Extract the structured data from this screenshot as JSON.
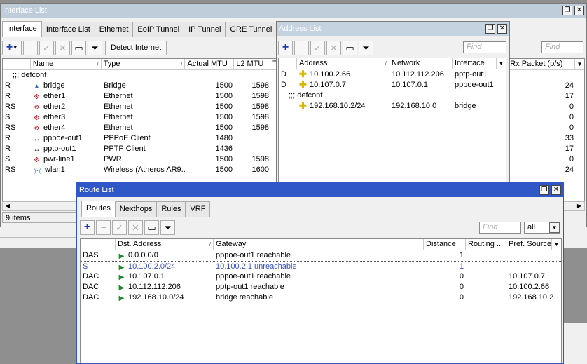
{
  "interface_window": {
    "title": "Interface List",
    "tabs": [
      "Interface",
      "Interface List",
      "Ethernet",
      "EoIP Tunnel",
      "IP Tunnel",
      "GRE Tunnel"
    ],
    "detect_internet": "Detect Internet",
    "find_placeholder": "Find",
    "columns": [
      "Name",
      "Type",
      "Actual MTU",
      "L2 MTU",
      "T"
    ],
    "rx_column": "Rx Packet (p/s)",
    "group": ";;; defconf",
    "rows": [
      {
        "flag": "R",
        "icon": "bridge-icon",
        "name": "bridge",
        "type": "Bridge",
        "mtu": "1500",
        "l2mtu": "1598",
        "rx": "24"
      },
      {
        "flag": "R",
        "icon": "ethernet-icon",
        "name": "ether1",
        "type": "Ethernet",
        "mtu": "1500",
        "l2mtu": "1598",
        "rx": "17"
      },
      {
        "flag": "RS",
        "icon": "ethernet-icon",
        "name": "ether2",
        "type": "Ethernet",
        "mtu": "1500",
        "l2mtu": "1598",
        "rx": "0"
      },
      {
        "flag": "S",
        "icon": "ethernet-icon",
        "name": "ether3",
        "type": "Ethernet",
        "mtu": "1500",
        "l2mtu": "1598",
        "rx": "0"
      },
      {
        "flag": "RS",
        "icon": "ethernet-icon",
        "name": "ether4",
        "type": "Ethernet",
        "mtu": "1500",
        "l2mtu": "1598",
        "rx": "0"
      },
      {
        "flag": "R",
        "icon": "ppp-icon",
        "name": "pppoe-out1",
        "type": "PPPoE Client",
        "mtu": "1480",
        "l2mtu": "",
        "rx": "33"
      },
      {
        "flag": "R",
        "icon": "ppp-icon",
        "name": "pptp-out1",
        "type": "PPTP Client",
        "mtu": "1436",
        "l2mtu": "",
        "rx": "17"
      },
      {
        "flag": "S",
        "icon": "ethernet-icon",
        "name": "pwr-line1",
        "type": "PWR",
        "mtu": "1500",
        "l2mtu": "1598",
        "rx": "0"
      },
      {
        "flag": "RS",
        "icon": "wireless-icon",
        "name": "wlan1",
        "type": "Wireless (Atheros AR9...",
        "mtu": "1500",
        "l2mtu": "1600",
        "rx": "24"
      }
    ],
    "status": "9 items"
  },
  "address_window": {
    "title": "Address List",
    "find_placeholder": "Find",
    "columns": [
      "Address",
      "Network",
      "Interface"
    ],
    "group": ";;; defconf",
    "rows": [
      {
        "flag": "D",
        "address": "10.100.2.66",
        "network": "10.112.112.206",
        "interface": "pptp-out1"
      },
      {
        "flag": "D",
        "address": "10.107.0.7",
        "network": "10.107.0.1",
        "interface": "pppoe-out1"
      }
    ],
    "group_rows": [
      {
        "flag": "",
        "address": "192.168.10.2/24",
        "network": "192.168.10.0",
        "interface": "bridge"
      }
    ]
  },
  "route_window": {
    "title": "Route List",
    "tabs": [
      "Routes",
      "Nexthops",
      "Rules",
      "VRF"
    ],
    "find_placeholder": "Find",
    "filter_value": "all",
    "columns": [
      "Dst. Address",
      "Gateway",
      "Distance",
      "Routing ...",
      "Pref. Source"
    ],
    "rows": [
      {
        "flag": "DAS",
        "dst": "0.0.0.0/0",
        "gateway": "pppoe-out1 reachable",
        "distance": "1",
        "routing": "",
        "pref": "",
        "unreachable": false
      },
      {
        "flag": "S",
        "dst": "10.100.2.0/24",
        "gateway": "10.100.2.1 unreachable",
        "distance": "1",
        "routing": "",
        "pref": "",
        "unreachable": true
      },
      {
        "flag": "DAC",
        "dst": "10.107.0.1",
        "gateway": "pppoe-out1 reachable",
        "distance": "0",
        "routing": "",
        "pref": "10.107.0.7",
        "unreachable": false
      },
      {
        "flag": "DAC",
        "dst": "10.112.112.206",
        "gateway": "pptp-out1 reachable",
        "distance": "0",
        "routing": "",
        "pref": "10.100.2.66",
        "unreachable": false
      },
      {
        "flag": "DAC",
        "dst": "192.168.10.0/24",
        "gateway": "bridge reachable",
        "distance": "0",
        "routing": "",
        "pref": "192.168.10.2",
        "unreachable": false
      }
    ]
  },
  "colors": {
    "active_title": "#2f57c8",
    "inactive_title": "#bfcddb",
    "unreachable": "#3a52c8"
  }
}
